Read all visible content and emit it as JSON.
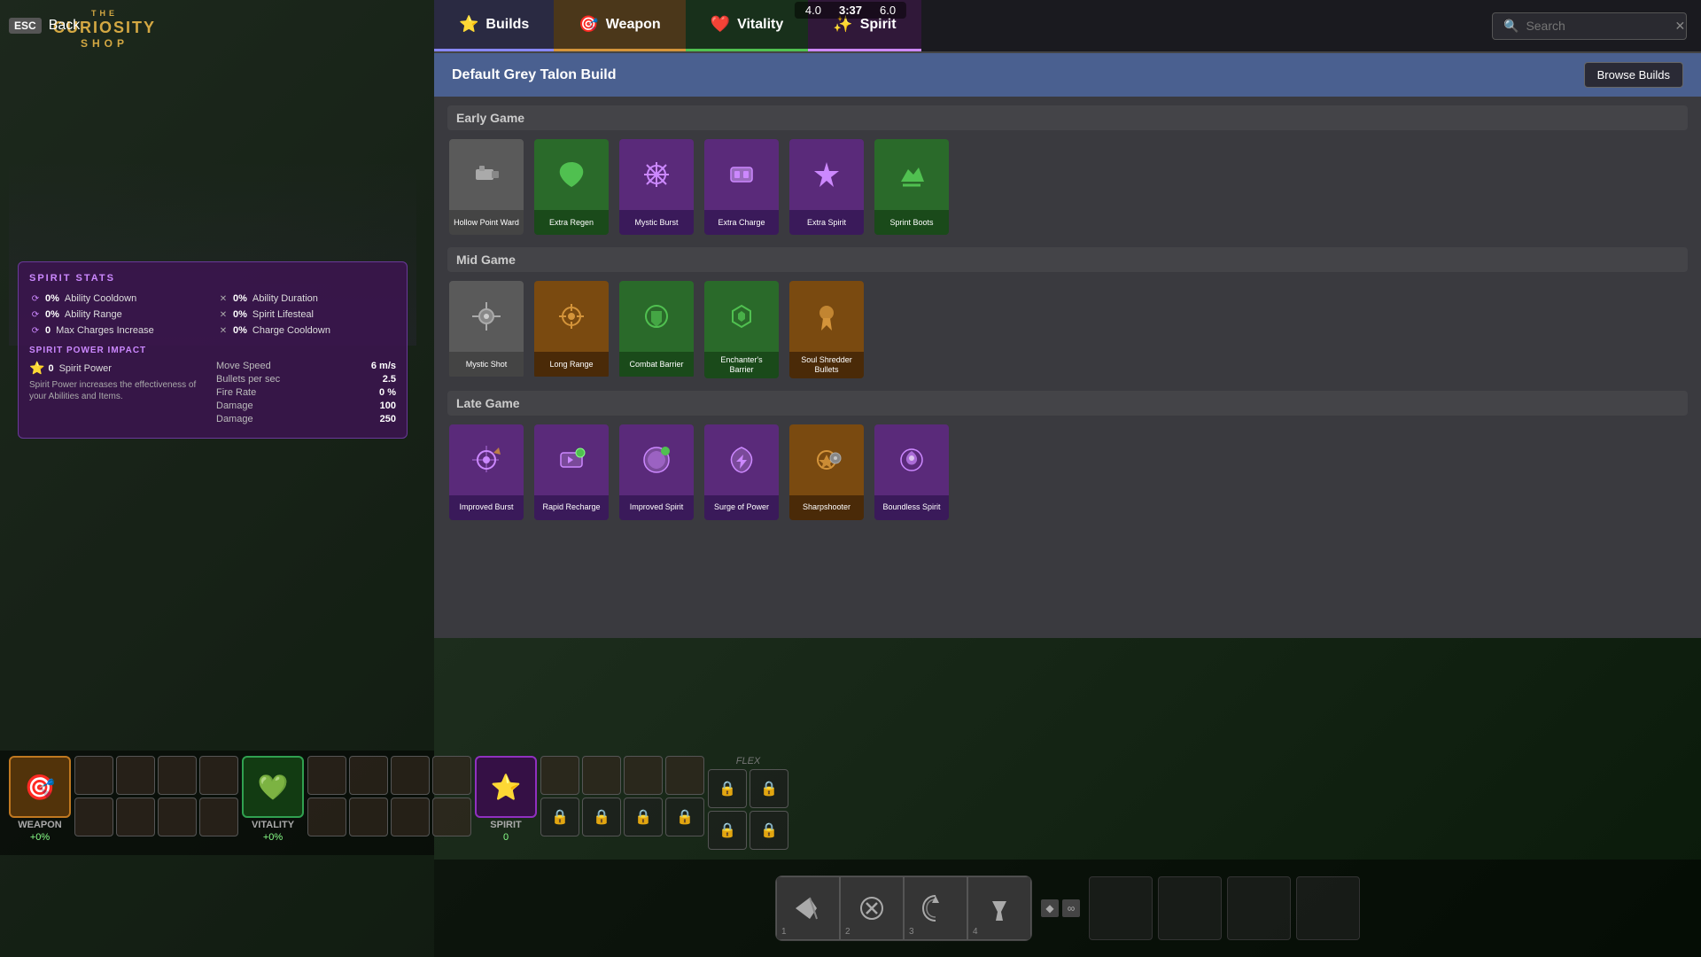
{
  "app": {
    "title": "The Curiosity Shop",
    "the": "THE",
    "curiosity": "CURIOSITY",
    "shop": "SHOP"
  },
  "header": {
    "back_label": "Back",
    "esc_label": "ESC"
  },
  "tabs": {
    "builds_label": "Builds",
    "weapon_label": "Weapon",
    "vitality_label": "Vitality",
    "spirit_label": "Spirit"
  },
  "search": {
    "placeholder": "Search",
    "value": ""
  },
  "build": {
    "title": "Default Grey Talon Build",
    "browse_label": "Browse Builds"
  },
  "phases": {
    "early": {
      "label": "Early Game",
      "items": [
        {
          "name": "Hollow Point Ward",
          "color": "grey",
          "icon": "🔫"
        },
        {
          "name": "Extra Regen",
          "color": "green",
          "icon": "💚"
        },
        {
          "name": "Mystic Burst",
          "color": "purple",
          "icon": "✳️"
        },
        {
          "name": "Extra Charge",
          "color": "purple",
          "icon": "⬛"
        },
        {
          "name": "Extra Spirit",
          "color": "purple",
          "icon": "💜"
        },
        {
          "name": "Sprint Boots",
          "color": "green",
          "icon": "🦶"
        }
      ]
    },
    "mid": {
      "label": "Mid Game",
      "items": [
        {
          "name": "Mystic Shot",
          "color": "grey",
          "icon": "⚙️"
        },
        {
          "name": "Long Range",
          "color": "orange",
          "icon": "🎯"
        },
        {
          "name": "Combat Barrier",
          "color": "green",
          "icon": "🛡️"
        },
        {
          "name": "Enchanter's Barrier",
          "color": "green",
          "icon": "🛡️"
        },
        {
          "name": "Soul Shredder Bullets",
          "color": "orange",
          "icon": "💀"
        }
      ]
    },
    "late": {
      "label": "Late Game",
      "items": [
        {
          "name": "Improved Burst",
          "color": "purple",
          "icon": "⚡"
        },
        {
          "name": "Rapid Recharge",
          "color": "purple",
          "icon": "🔋"
        },
        {
          "name": "Improved Spirit",
          "color": "purple",
          "icon": "✨"
        },
        {
          "name": "Surge of Power",
          "color": "purple",
          "icon": "🌀"
        },
        {
          "name": "Sharpshooter",
          "color": "orange",
          "icon": "▶️"
        },
        {
          "name": "Boundless Spirit",
          "color": "purple",
          "icon": "🌟"
        }
      ]
    }
  },
  "spirit_stats": {
    "title": "SPIRIT STATS",
    "stats": [
      {
        "label": "Ability Cooldown",
        "value": "0%",
        "icon": "⟳"
      },
      {
        "label": "Ability Duration",
        "value": "0%",
        "icon": "✕"
      },
      {
        "label": "Ability Range",
        "value": "0%",
        "icon": "⟳"
      },
      {
        "label": "Spirit Lifesteal",
        "value": "0%",
        "icon": "✕"
      },
      {
        "label": "Max Charges Increase",
        "value": "0",
        "icon": "⟳"
      },
      {
        "label": "Charge Cooldown",
        "value": "0%",
        "icon": "✕"
      }
    ]
  },
  "spirit_power": {
    "title": "SPIRIT POWER IMPACT",
    "spirit_power_label": "Spirit Power",
    "spirit_power_value": "0",
    "description": "Spirit Power increases the effectiveness of your Abilities and Items.",
    "impact_rows": [
      {
        "label": "Move Speed",
        "value": "6 m/s"
      },
      {
        "label": "Bullets per sec",
        "value": "2.5"
      },
      {
        "label": "Fire Rate",
        "value": "0 %"
      },
      {
        "label": "Damage",
        "value": "100"
      },
      {
        "label": "Damage",
        "value": "250"
      }
    ]
  },
  "equipment": {
    "weapon": {
      "label": "WEAPON",
      "value": "+0%",
      "icon": "🎯"
    },
    "vitality": {
      "label": "VITALITY",
      "value": "+0%",
      "icon": "💚"
    },
    "spirit": {
      "label": "SPIRIT",
      "value": "0",
      "icon": "⭐"
    },
    "flex_label": "FLEX"
  },
  "skills": [
    {
      "icon": "➤",
      "num": "1",
      "active": false
    },
    {
      "icon": "✂",
      "num": "2",
      "active": false
    },
    {
      "icon": "🌀",
      "num": "3",
      "active": false
    },
    {
      "icon": "👆",
      "num": "4",
      "active": false
    }
  ],
  "topbar": {
    "time": "3:37",
    "score1": "4.0",
    "score2": "6.0"
  },
  "colors": {
    "weapon_accent": "#d4943a",
    "vitality_accent": "#50c050",
    "spirit_accent": "#cc88ff",
    "builds_accent": "#8888ff"
  }
}
